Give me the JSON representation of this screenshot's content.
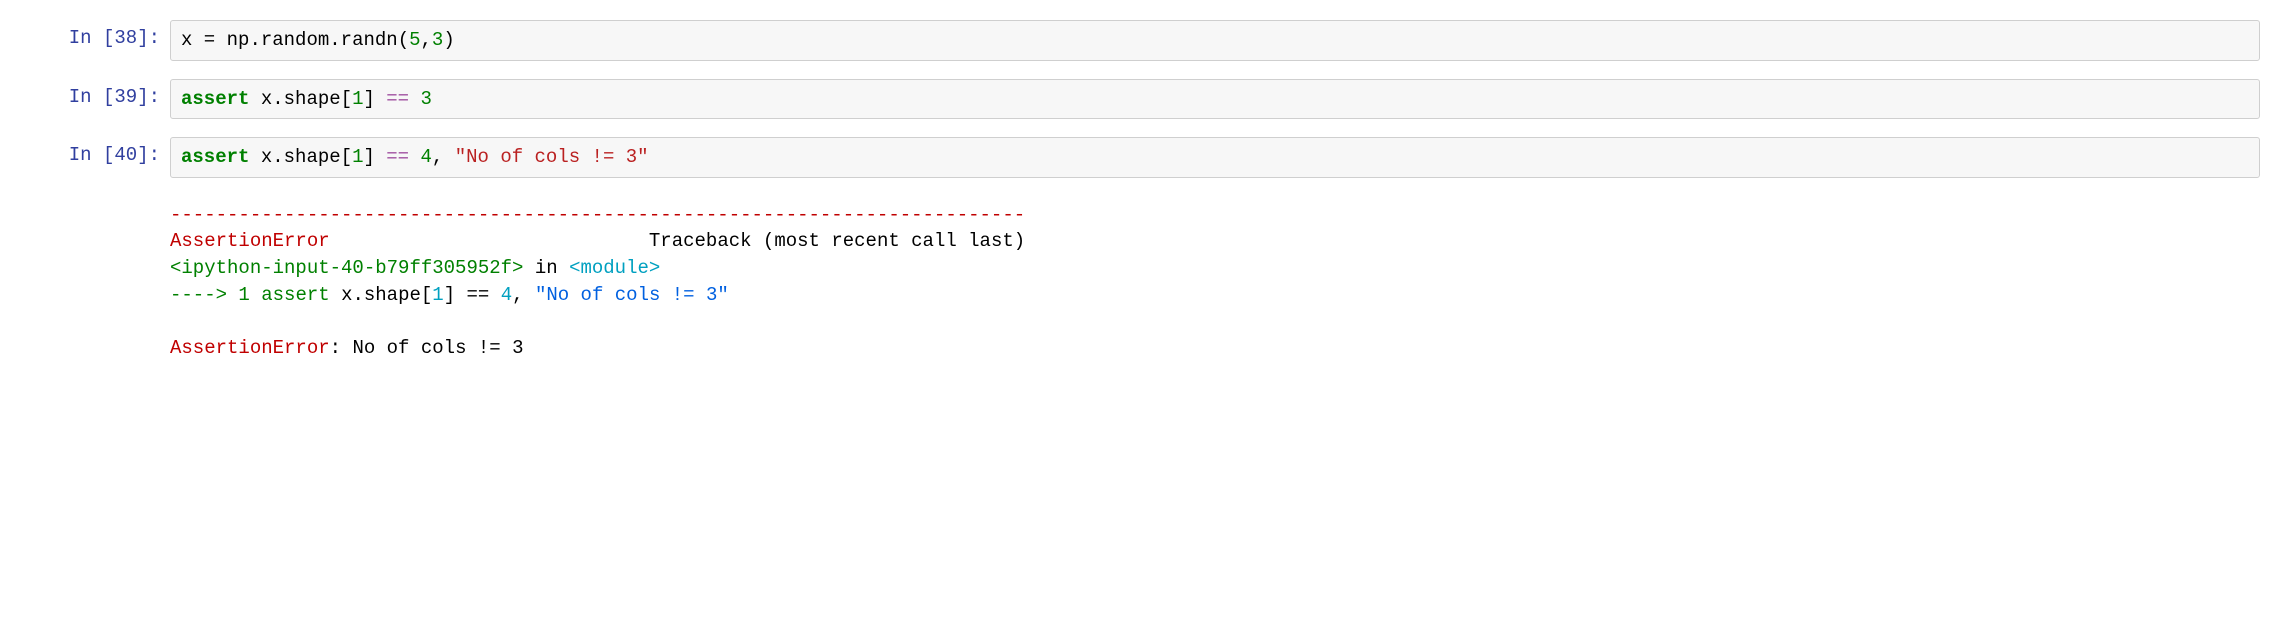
{
  "cells": [
    {
      "prompt_label": "In ",
      "prompt_num": "38",
      "code": {
        "var": "x",
        "assign": " = ",
        "mod": "np",
        "dot1": ".",
        "attr1": "random",
        "dot2": ".",
        "attr2": "randn",
        "lparen": "(",
        "arg1": "5",
        "comma": ",",
        "arg2": "3",
        "rparen": ")"
      }
    },
    {
      "prompt_label": "In ",
      "prompt_num": "39",
      "code": {
        "kw": "assert",
        "sp1": " ",
        "var": "x",
        "dot": ".",
        "attr": "shape",
        "lbrack": "[",
        "idx": "1",
        "rbrack": "]",
        "sp2": " ",
        "cmp": "==",
        "sp3": " ",
        "val": "3"
      }
    },
    {
      "prompt_label": "In ",
      "prompt_num": "40",
      "code": {
        "kw": "assert",
        "sp1": " ",
        "var": "x",
        "dot": ".",
        "attr": "shape",
        "lbrack": "[",
        "idx": "1",
        "rbrack": "]",
        "sp2": " ",
        "cmp": "==",
        "sp3": " ",
        "val": "4",
        "comma": ", ",
        "msg": "\"No of cols != 3\""
      }
    }
  ],
  "traceback": {
    "sep": "---------------------------------------------------------------------------",
    "err_name": "AssertionError",
    "header_spaces": "                            ",
    "header_right": "Traceback (most recent call last)",
    "src_ref": "<ipython-input-40-b79ff305952f>",
    "in_word": " in ",
    "module": "<module>",
    "arrow": "----> 1",
    "sp": " ",
    "kw": "assert",
    "sp2": " ",
    "var": "x",
    "dot": ".",
    "attr": "shape",
    "lbrack": "[",
    "idx": "1",
    "rbrack": "]",
    "sp3": " ",
    "cmp": "==",
    "sp4": " ",
    "val": "4",
    "comma": ", ",
    "msg": "\"No of cols != 3\"",
    "blank": "",
    "final_err": "AssertionError",
    "final_colon": ": ",
    "final_msg": "No of cols != 3"
  }
}
